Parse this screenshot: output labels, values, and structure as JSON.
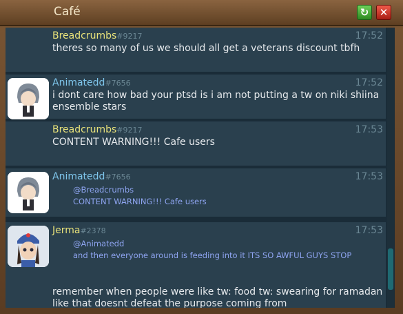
{
  "window": {
    "title": "Café"
  },
  "messages": [
    {
      "user": "Breadcrumbs",
      "id": "#9217",
      "time": "17:52",
      "text": "theres so many of us we should all get a veterans discount tbfh"
    },
    {
      "user": "Animatedd",
      "id": "#7656",
      "time": "17:52",
      "text": "i dont care how bad your ptsd is i am not putting a tw on niki shiina ensemble stars"
    },
    {
      "user": "Breadcrumbs",
      "id": "#9217",
      "time": "17:53",
      "text": "CONTENT WARNING!!! Cafe users"
    },
    {
      "user": "Animatedd",
      "id": "#7656",
      "time": "17:53",
      "quote_user": "@Breadcrumbs",
      "quote_text": "CONTENT WARNING!!! Cafe users"
    },
    {
      "user": "Jerma",
      "id": "#2378",
      "time": "17:53",
      "quote_user": "@Animatedd",
      "quote_text": "and then everyone around is feeding into it ITS SO AWFUL GUYS STOP",
      "text": "remember when people were like tw: food tw: swearing for ramadan like that doesnt defeat the purpose  coming from"
    }
  ]
}
